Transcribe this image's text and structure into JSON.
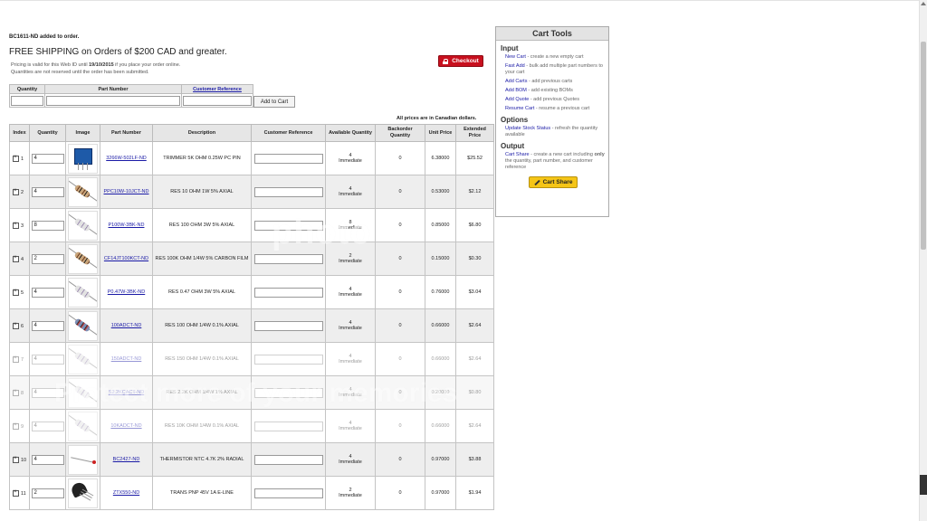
{
  "notice": {
    "added": "BC1611-ND added to order.",
    "free_shipping": "FREE SHIPPING on Orders of $200 CAD and greater.",
    "pricing_prefix": "Pricing is valid for this Web ID until",
    "pricing_date": "19/10/2015",
    "pricing_suffix": "if you place your order online.",
    "reservation": "Quantities are not reserved until the order has been submitted."
  },
  "checkout": {
    "label": "Checkout"
  },
  "quick_add": {
    "headers": {
      "quantity": "Quantity",
      "part_number": "Part Number",
      "customer_reference": "Customer Reference"
    },
    "button": "Add to Cart"
  },
  "prices_note": "All prices are in Canadian dollars.",
  "table": {
    "headers": {
      "index": "Index",
      "quantity": "Quantity",
      "image": "Image",
      "part_number": "Part Number",
      "description": "Description",
      "customer_reference": "Customer Reference",
      "available": "Available Quantity",
      "backorder": "Backorder Quantity",
      "unit_price": "Unit Price",
      "extended": "Extended Price"
    },
    "rows": [
      {
        "index": "1",
        "qty": "4",
        "part": "3266W-502LF-ND",
        "desc": "TRIMMER 5K OHM 0.25W PC PIN",
        "avail": "4",
        "status": "Immediate",
        "backorder": "0",
        "unit": "6.38000",
        "ext": "$25.52",
        "img": "trimmer-image"
      },
      {
        "index": "2",
        "qty": "4",
        "part": "PPC10W-10JCT-ND",
        "desc": "RES 10 OHM 1W 5% AXIAL",
        "avail": "4",
        "status": "Immediate",
        "backorder": "0",
        "unit": "0.53000",
        "ext": "$2.12",
        "img": "resistor-image"
      },
      {
        "index": "3",
        "qty": "8",
        "part": "P100W-3BK-ND",
        "desc": "RES 100 OHM 3W 5% AXIAL",
        "avail": "8",
        "status": "Immediate",
        "backorder": "0",
        "unit": "0.85000",
        "ext": "$6.80",
        "img": "resistor-image"
      },
      {
        "index": "4",
        "qty": "2",
        "part": "CF14JT100KCT-ND",
        "desc": "RES 100K OHM 1/4W 5% CARBON FILM",
        "avail": "2",
        "status": "Immediate",
        "backorder": "0",
        "unit": "0.15000",
        "ext": "$0.30",
        "img": "resistor-image"
      },
      {
        "index": "5",
        "qty": "4",
        "part": "P0.47W-3BK-ND",
        "desc": "RES 0.47 OHM 3W 5% AXIAL",
        "avail": "4",
        "status": "Immediate",
        "backorder": "0",
        "unit": "0.76000",
        "ext": "$3.04",
        "img": "resistor-image"
      },
      {
        "index": "6",
        "qty": "4",
        "part": "100ADCT-ND",
        "desc": "RES 100 OHM 1/4W 0.1% AXIAL",
        "avail": "4",
        "status": "Immediate",
        "backorder": "0",
        "unit": "0.66000",
        "ext": "$2.64",
        "img": "resistor-image"
      },
      {
        "index": "7",
        "qty": "4",
        "part": "150ADCT-ND",
        "desc": "RES 150 OHM 1/4W 0.1% AXIAL",
        "avail": "4",
        "status": "Immediate",
        "backorder": "0",
        "unit": "0.66000",
        "ext": "$2.64",
        "img": "resistor-image"
      },
      {
        "index": "8",
        "qty": "4",
        "part": "S2.2KCACT-ND",
        "desc": "RES 2.2K OHM 1/4W 1% AXIAL",
        "avail": "4",
        "status": "Immediate",
        "backorder": "0",
        "unit": "0.20000",
        "ext": "$0.80",
        "img": "resistor-image"
      },
      {
        "index": "9",
        "qty": "4",
        "part": "10KADCT-ND",
        "desc": "RES 10K OHM 1/4W 0.1% AXIAL",
        "avail": "4",
        "status": "Immediate",
        "backorder": "0",
        "unit": "0.66000",
        "ext": "$2.64",
        "img": "resistor-image"
      },
      {
        "index": "10",
        "qty": "4",
        "part": "BC2427-ND",
        "desc": "THERMISTOR NTC 4.7K 2% RADIAL",
        "avail": "4",
        "status": "Immediate",
        "backorder": "0",
        "unit": "0.97000",
        "ext": "$3.88",
        "img": "thermistor-image"
      },
      {
        "index": "11",
        "qty": "2",
        "part": "ZTX550-ND",
        "desc": "TRANS PNP 45V 1A E-LINE",
        "avail": "2",
        "status": "Immediate",
        "backorder": "0",
        "unit": "0.97000",
        "ext": "$1.94",
        "img": "transistor-image"
      }
    ]
  },
  "cart_tools": {
    "title": "Cart Tools",
    "input_heading": "Input",
    "input_items": [
      {
        "link": "New Cart",
        "text": " - create a new empty cart"
      },
      {
        "link": "Fast Add",
        "text": " - bulk add multiple part numbers to your cart"
      },
      {
        "link": "Add Carts",
        "text": " - add previous carts"
      },
      {
        "link": "Add BOM",
        "text": " - add existing BOMs"
      },
      {
        "link": "Add Quote",
        "text": " - add previous Quotes"
      },
      {
        "link": "Resume Cart",
        "text": " - resume a previous cart"
      }
    ],
    "options_heading": "Options",
    "options_items": [
      {
        "link": "Update Stock Status",
        "text": " - refresh the quantity available"
      }
    ],
    "output_heading": "Output",
    "output_items": [
      {
        "link": "Cart Share",
        "text": " - create a new cart including ",
        "bold": "only",
        "text2": " the quantity, part number, and customer reference"
      }
    ],
    "share_button": "Cart Share"
  },
  "watermark": {
    "top": "photo",
    "bottom": "Protect more of your memories"
  }
}
